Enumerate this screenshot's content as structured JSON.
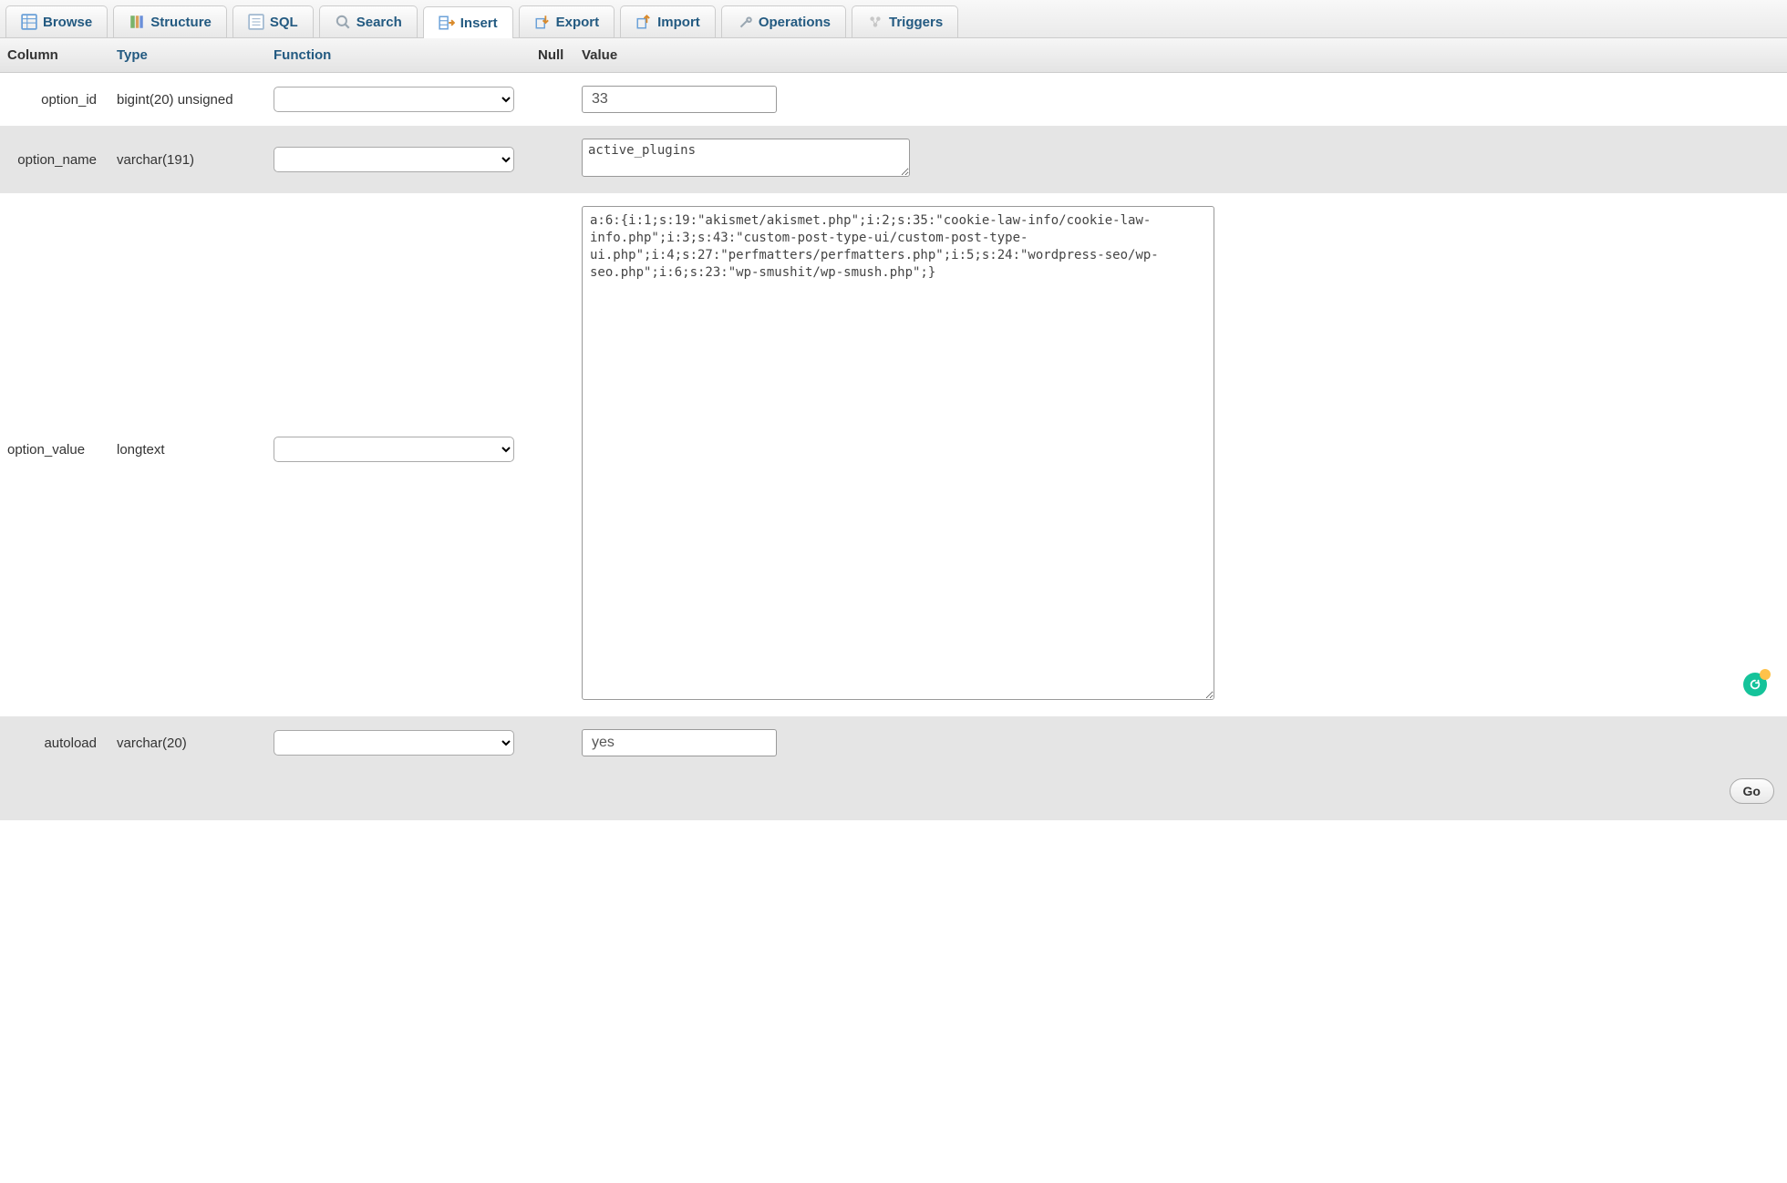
{
  "tabs": [
    {
      "label": "Browse",
      "icon": "browse"
    },
    {
      "label": "Structure",
      "icon": "structure"
    },
    {
      "label": "SQL",
      "icon": "sql"
    },
    {
      "label": "Search",
      "icon": "search"
    },
    {
      "label": "Insert",
      "icon": "insert",
      "active": true
    },
    {
      "label": "Export",
      "icon": "export"
    },
    {
      "label": "Import",
      "icon": "import"
    },
    {
      "label": "Operations",
      "icon": "operations"
    },
    {
      "label": "Triggers",
      "icon": "triggers"
    }
  ],
  "header": {
    "column": "Column",
    "type": "Type",
    "function": "Function",
    "null": "Null",
    "value": "Value"
  },
  "rows": [
    {
      "column": "option_id",
      "type": "bigint(20) unsigned",
      "value": "33"
    },
    {
      "column": "option_name",
      "type": "varchar(191)",
      "value": "active_plugins"
    },
    {
      "column": "option_value",
      "type": "longtext",
      "value": "a:6:{i:1;s:19:\"akismet/akismet.php\";i:2;s:35:\"cookie-law-info/cookie-law-info.php\";i:3;s:43:\"custom-post-type-ui/custom-post-type-ui.php\";i:4;s:27:\"perfmatters/perfmatters.php\";i:5;s:24:\"wordpress-seo/wp-seo.php\";i:6;s:23:\"wp-smushit/wp-smush.php\";}"
    },
    {
      "column": "autoload",
      "type": "varchar(20)",
      "value": "yes"
    }
  ],
  "footer": {
    "go_label": "Go"
  }
}
